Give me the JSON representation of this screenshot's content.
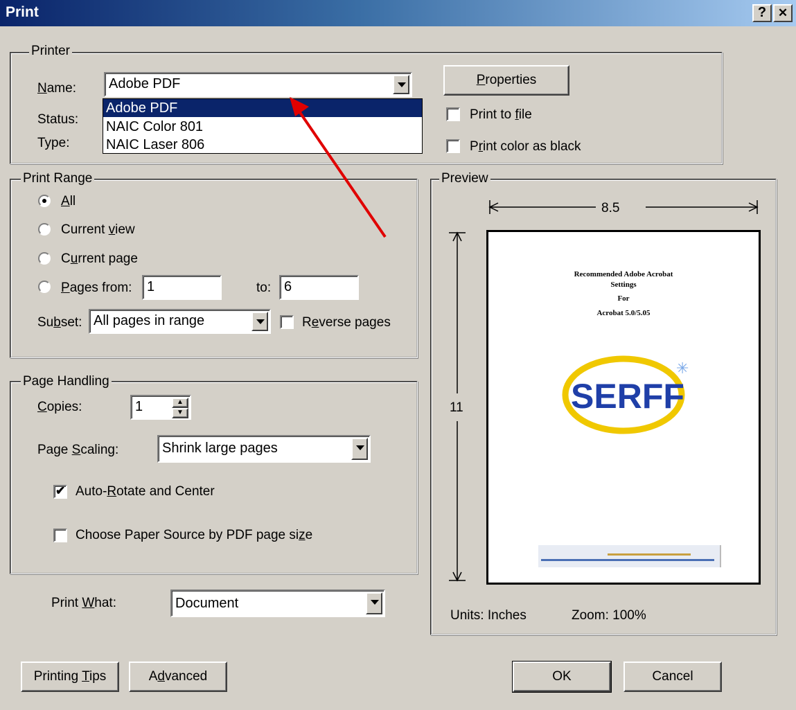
{
  "window": {
    "title": "Print",
    "help_label": "?",
    "close_label": "✕"
  },
  "printer": {
    "legend": "Printer",
    "name_label": "Name:",
    "status_label": "Status:",
    "type_label": "Type:",
    "selected": "Adobe PDF",
    "options": [
      "Adobe PDF",
      "NAIC Color 801",
      "NAIC Laser 806"
    ],
    "properties_label": "Properties",
    "print_to_file_label": "Print to file",
    "print_color_black_label": "Print color as black"
  },
  "print_range": {
    "legend": "Print Range",
    "all_label": "All",
    "current_view_label": "Current view",
    "current_page_label": "Current page",
    "pages_from_label": "Pages from:",
    "from_value": "1",
    "to_label": "to:",
    "to_value": "6",
    "subset_label": "Subset:",
    "subset_value": "All pages in range",
    "reverse_label": "Reverse pages"
  },
  "page_handling": {
    "legend": "Page Handling",
    "copies_label": "Copies:",
    "copies_value": "1",
    "scaling_label": "Page Scaling:",
    "scaling_value": "Shrink large pages",
    "auto_rotate_label": "Auto-Rotate and Center",
    "paper_source_label": "Choose Paper Source by PDF page size"
  },
  "print_what": {
    "label": "Print What:",
    "value": "Document"
  },
  "preview": {
    "legend": "Preview",
    "width_label": "8.5",
    "height_label": "11",
    "doc_title_1": "Recommended Adobe Acrobat",
    "doc_title_2": "Settings",
    "doc_title_3": "For",
    "doc_title_4": "Acrobat 5.0/5.05",
    "logo_text": "SERFF",
    "units_label": "Units: Inches",
    "zoom_label": "Zoom: 100%"
  },
  "buttons": {
    "tips": "Printing Tips",
    "advanced": "Advanced",
    "ok": "OK",
    "cancel": "Cancel"
  },
  "colors": {
    "title_start": "#0a246a",
    "title_end": "#a6caf0",
    "annotation_arrow": "#e00000",
    "logo_blue": "#1f3fa8",
    "logo_yellow": "#f0c800"
  }
}
